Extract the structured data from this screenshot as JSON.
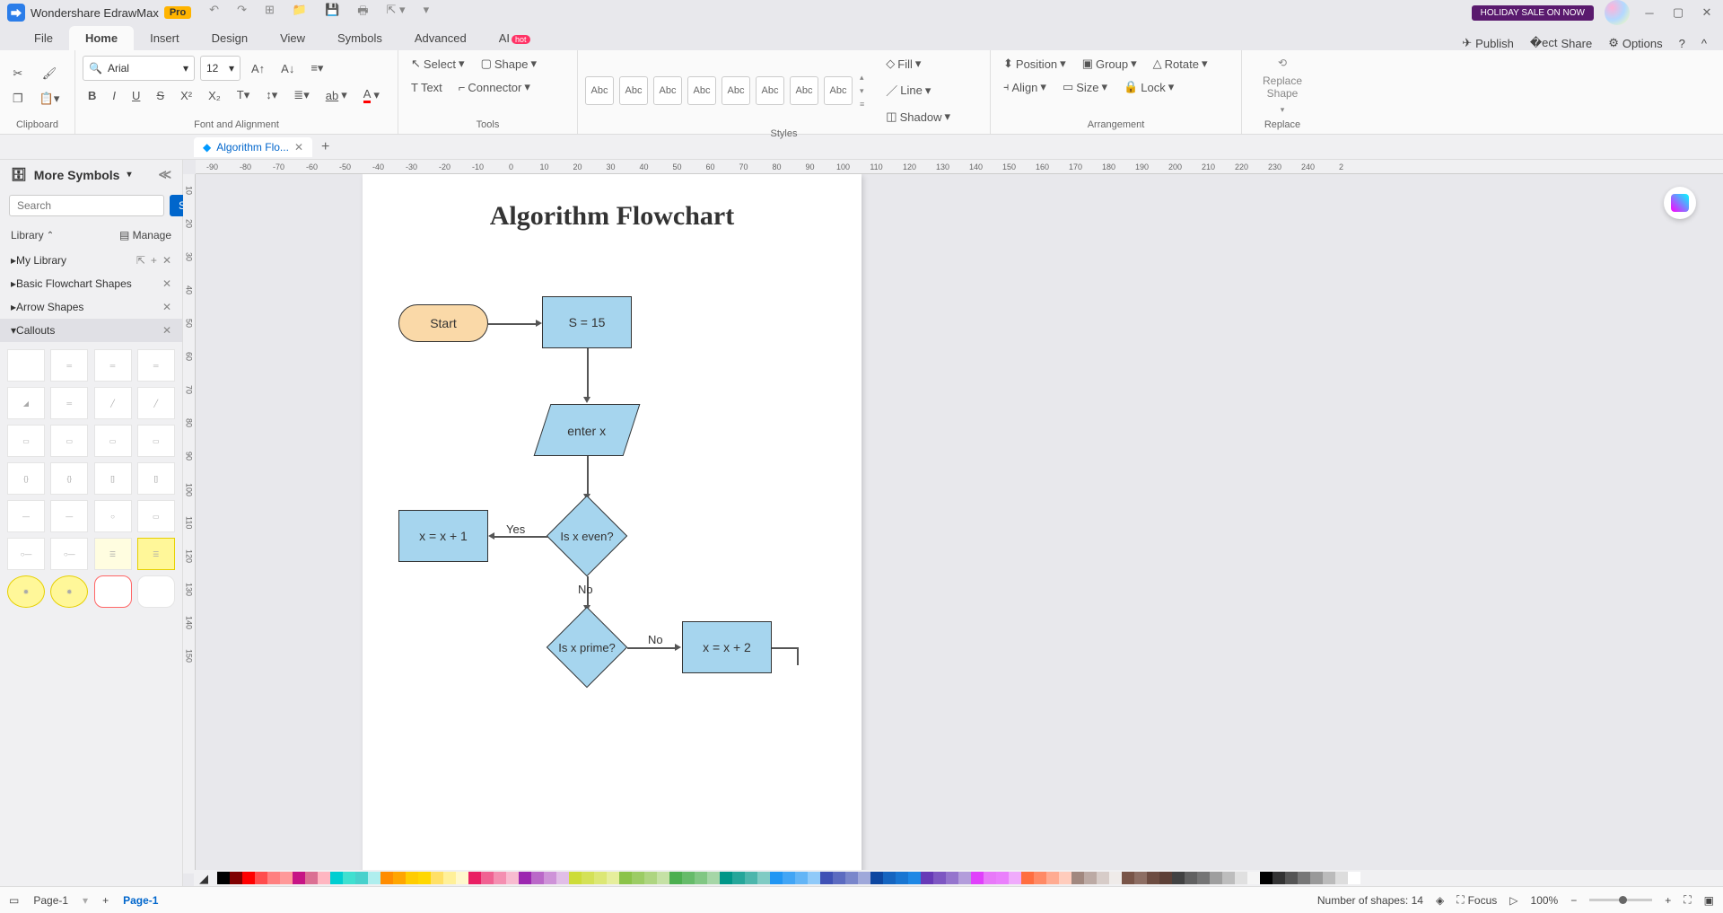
{
  "app": {
    "title": "Wondershare EdrawMax",
    "pro": "Pro",
    "holiday": "HOLIDAY SALE ON NOW"
  },
  "menus": {
    "file": "File",
    "home": "Home",
    "insert": "Insert",
    "design": "Design",
    "view": "View",
    "symbols": "Symbols",
    "advanced": "Advanced",
    "ai": "AI",
    "hot": "hot",
    "publish": "Publish",
    "share": "Share",
    "options": "Options"
  },
  "ribbon": {
    "clipboard": "Clipboard",
    "font_alignment": "Font and Alignment",
    "font_name": "Arial",
    "font_size": "12",
    "tools": "Tools",
    "select": "Select",
    "shape": "Shape",
    "text": "Text",
    "connector": "Connector",
    "styles": "Styles",
    "abc": "Abc",
    "fill": "Fill",
    "line": "Line",
    "shadow": "Shadow",
    "position": "Position",
    "group": "Group",
    "rotate": "Rotate",
    "align": "Align",
    "size": "Size",
    "lock": "Lock",
    "arrangement": "Arrangement",
    "replace_shape": "Replace Shape",
    "replace": "Replace"
  },
  "doctab": "Algorithm Flo...",
  "more_symbols": "More Symbols",
  "search_btn": "Search",
  "search_ph": "Search",
  "library": "Library",
  "manage": "Manage",
  "sections": {
    "mylib": "My Library",
    "basic": "Basic Flowchart Shapes",
    "arrow": "Arrow Shapes",
    "callouts": "Callouts"
  },
  "canvas": {
    "title": "Algorithm Flowchart",
    "start": "Start",
    "s15": "S = 15",
    "enterx": "enter x",
    "iseven": "Is x even?",
    "xplus1": "x = x + 1",
    "isprime": "Is x prime?",
    "xplus2": "x = x + 2",
    "yes": "Yes",
    "no": "No"
  },
  "ruler_h": [
    "-90",
    "-80",
    "-70",
    "-60",
    "-50",
    "-40",
    "-30",
    "-20",
    "-10",
    "0",
    "10",
    "20",
    "30",
    "40",
    "50",
    "60",
    "70",
    "80",
    "90",
    "100",
    "110",
    "120",
    "130",
    "140",
    "150",
    "160",
    "170",
    "180",
    "190",
    "200",
    "210",
    "220",
    "230",
    "240",
    "2"
  ],
  "ruler_v": [
    "10",
    "20",
    "30",
    "40",
    "50",
    "60",
    "70",
    "80",
    "90",
    "100",
    "110",
    "120",
    "130",
    "140",
    "150"
  ],
  "status": {
    "page1": "Page-1",
    "page1_tab": "Page-1",
    "shapes": "Number of shapes: 14",
    "focus": "Focus",
    "zoom": "100%"
  },
  "palette": [
    "#000",
    "#800000",
    "#f00",
    "#ff4d4d",
    "#ff8080",
    "#ff9999",
    "#c71585",
    "#db7093",
    "#ffb6c1",
    "#00ced1",
    "#40e0d0",
    "#48d1cc",
    "#afeeee",
    "#ff8c00",
    "#ffa500",
    "#ffcc00",
    "#ffd700",
    "#ffe066",
    "#fff099",
    "#fff8cc",
    "#e91e63",
    "#f06292",
    "#f48fb1",
    "#f8bbd0",
    "#9c27b0",
    "#ba68c8",
    "#ce93d8",
    "#e1bee7",
    "#cddc39",
    "#d4e157",
    "#dce775",
    "#e6ee9c",
    "#8bc34a",
    "#9ccc65",
    "#aed581",
    "#c5e1a5",
    "#4caf50",
    "#66bb6a",
    "#81c784",
    "#a5d6a7",
    "#009688",
    "#26a69a",
    "#4db6ac",
    "#80cbc4",
    "#2196f3",
    "#42a5f5",
    "#64b5f6",
    "#90caf9",
    "#3f51b5",
    "#5c6bc0",
    "#7986cb",
    "#9fa8da",
    "#0d47a1",
    "#1565c0",
    "#1976d2",
    "#1e88e5",
    "#673ab7",
    "#7e57c2",
    "#9575cd",
    "#b39ddb",
    "#e040fb",
    "#e879f9",
    "#ea80fc",
    "#f0abfc",
    "#ff6e40",
    "#ff8a65",
    "#ffab91",
    "#ffccbc",
    "#a1887f",
    "#bcaaa4",
    "#d7ccc8",
    "#efebe9",
    "#795548",
    "#8d6e63",
    "#6d4c41",
    "#5d4037",
    "#424242",
    "#616161",
    "#757575",
    "#9e9e9e",
    "#bdbdbd",
    "#e0e0e0",
    "#f5f5f5",
    "#000",
    "#333",
    "#555",
    "#777",
    "#999",
    "#bbb",
    "#ddd",
    "#fff"
  ]
}
